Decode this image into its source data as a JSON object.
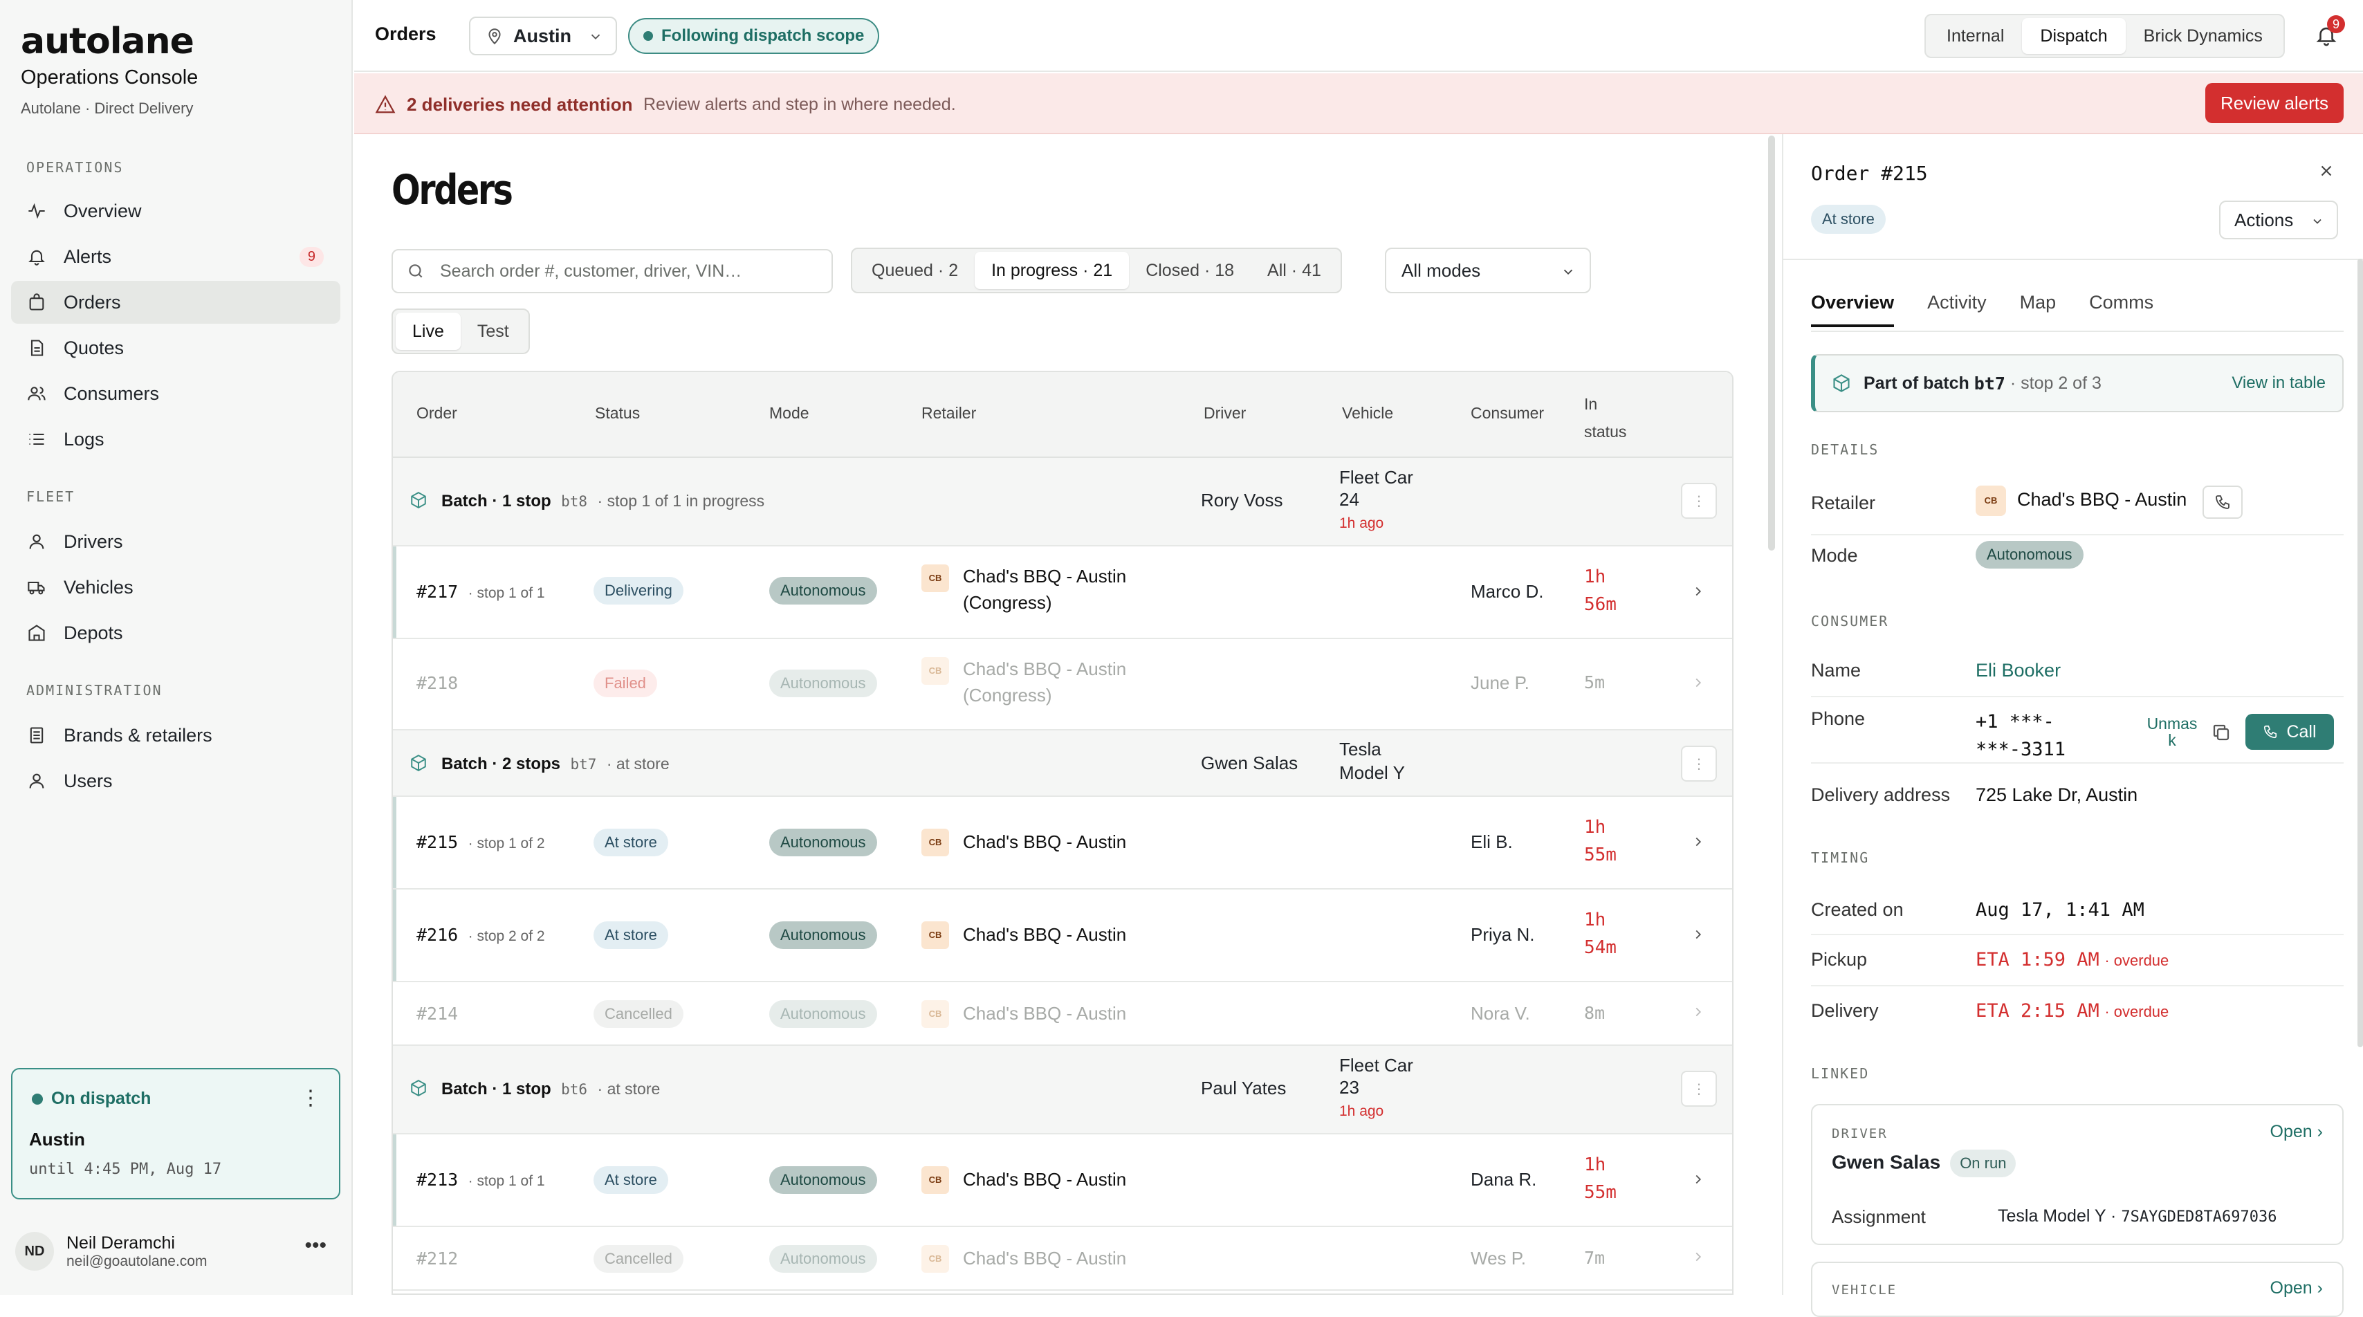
{
  "brand": {
    "logo": "autolane",
    "title": "Operations Console",
    "subtitle": "Autolane · Direct Delivery"
  },
  "sidebar": {
    "sections": {
      "operations": "OPERATIONS",
      "fleet": "FLEET",
      "administration": "ADMINISTRATION"
    },
    "items": [
      {
        "label": "Overview",
        "icon": "pulse-icon"
      },
      {
        "label": "Alerts",
        "icon": "bell-icon",
        "badge": "9"
      },
      {
        "label": "Orders",
        "icon": "bag-icon",
        "active": true
      },
      {
        "label": "Quotes",
        "icon": "document-icon"
      },
      {
        "label": "Consumers",
        "icon": "users-icon"
      },
      {
        "label": "Logs",
        "icon": "list-icon"
      },
      {
        "label": "Drivers",
        "icon": "person-icon"
      },
      {
        "label": "Vehicles",
        "icon": "truck-icon"
      },
      {
        "label": "Depots",
        "icon": "building-icon"
      },
      {
        "label": "Brands & retailers",
        "icon": "ledger-icon"
      },
      {
        "label": "Users",
        "icon": "person-icon"
      }
    ],
    "dispatch": {
      "title": "On dispatch",
      "city": "Austin",
      "until": "until 4:45 PM, Aug 17"
    },
    "user": {
      "initials": "ND",
      "name": "Neil Deramchi",
      "email": "neil@goautolane.com"
    }
  },
  "topbar": {
    "section": "Orders",
    "city": "Austin",
    "scope": "Following dispatch scope",
    "views": [
      "Internal",
      "Dispatch",
      "Brick Dynamics"
    ],
    "active_view": "Dispatch",
    "notifications": "9"
  },
  "alert": {
    "title": "2 deliveries need attention",
    "text": "Review alerts and step in where needed.",
    "button": "Review alerts"
  },
  "main": {
    "title": "Orders",
    "search_placeholder": "Search order #, customer, driver, VIN…",
    "filters": [
      {
        "label": "Queued",
        "count": "2"
      },
      {
        "label": "In progress",
        "count": "21",
        "active": true
      },
      {
        "label": "Closed",
        "count": "18"
      },
      {
        "label": "All",
        "count": "41"
      }
    ],
    "modes": "All modes",
    "env": [
      "Live",
      "Test"
    ],
    "env_active": "Live"
  },
  "table": {
    "headers": {
      "order": "Order",
      "status": "Status",
      "mode": "Mode",
      "retailer": "Retailer",
      "driver": "Driver",
      "vehicle": "Vehicle",
      "consumer": "Consumer",
      "in_status_1": "In",
      "in_status_2": "status"
    },
    "rows": [
      {
        "kind": "batch",
        "title": "Batch · 1 stop",
        "code": "bt8",
        "note": "· stop 1 of 1 in progress",
        "driver": "Rory Voss",
        "vehicle": "Fleet Car 24",
        "vehicle_1": "Fleet Car",
        "vehicle_2": "24",
        "ago": "1h ago"
      },
      {
        "kind": "order",
        "no": "#217",
        "stop": "· stop 1 of 1",
        "status": "Delivering",
        "mode": "Autonomous",
        "retailer_1": "Chad's BBQ - Austin",
        "retailer_2": "(Congress)",
        "consumer": "Marco D.",
        "time_1": "1h",
        "time_2": "56m"
      },
      {
        "kind": "order-dim",
        "no": "#218",
        "status": "Failed",
        "mode": "Autonomous",
        "retailer_1": "Chad's BBQ - Austin",
        "retailer_2": "(Congress)",
        "consumer": "June P.",
        "time": "5m"
      },
      {
        "kind": "batch",
        "title": "Batch · 2 stops",
        "code": "bt7",
        "note": "· at store",
        "driver": "Gwen Salas",
        "vehicle_1": "Tesla",
        "vehicle_2": "Model Y"
      },
      {
        "kind": "order",
        "no": "#215",
        "stop": "· stop 1 of 2",
        "status": "At store",
        "mode": "Autonomous",
        "retailer_1": "Chad's BBQ - Austin",
        "consumer": "Eli B.",
        "time_1": "1h",
        "time_2": "55m"
      },
      {
        "kind": "order",
        "no": "#216",
        "stop": "· stop 2 of 2",
        "status": "At store",
        "mode": "Autonomous",
        "retailer_1": "Chad's BBQ - Austin",
        "consumer": "Priya N.",
        "time_1": "1h",
        "time_2": "54m"
      },
      {
        "kind": "order-dim",
        "no": "#214",
        "status": "Cancelled",
        "mode": "Autonomous",
        "retailer_1": "Chad's BBQ - Austin",
        "consumer": "Nora V.",
        "time": "8m"
      },
      {
        "kind": "batch",
        "title": "Batch · 1 stop",
        "code": "bt6",
        "note": "· at store",
        "driver": "Paul Yates",
        "vehicle_1": "Fleet Car",
        "vehicle_2": "23",
        "ago": "1h ago"
      },
      {
        "kind": "order",
        "no": "#213",
        "stop": "· stop 1 of 1",
        "status": "At store",
        "mode": "Autonomous",
        "retailer_1": "Chad's BBQ - Austin",
        "consumer": "Dana R.",
        "time_1": "1h",
        "time_2": "55m"
      },
      {
        "kind": "order-dim",
        "no": "#212",
        "status": "Cancelled",
        "mode": "Autonomous",
        "retailer_1": "Chad's BBQ - Austin",
        "consumer": "Wes P.",
        "time": "7m"
      }
    ],
    "logo_text": "CB"
  },
  "panel": {
    "title": "Order #215",
    "status": "At store",
    "actions": "Actions",
    "tabs": [
      "Overview",
      "Activity",
      "Map",
      "Comms"
    ],
    "batch": {
      "prefix": "Part of batch",
      "code": "bt7",
      "stop": "· stop 2 of 3",
      "link": "View in table"
    },
    "details_label": "DETAILS",
    "retailer_key": "Retailer",
    "retailer": "Chad's BBQ - Austin",
    "mode_key": "Mode",
    "mode": "Autonomous",
    "consumer_label": "CONSUMER",
    "name_key": "Name",
    "name": "Eli Booker",
    "phone_key": "Phone",
    "phone_1": "+1 ***-",
    "phone_2": "***-3311",
    "unmask": "Unmask",
    "unmask_1": "Unmas",
    "unmask_2": "k",
    "call": "Call",
    "address_key": "Delivery address",
    "address": "725 Lake Dr, Austin",
    "timing_label": "TIMING",
    "created_key": "Created on",
    "created": "Aug 17, 1:41 AM",
    "pickup_key": "Pickup",
    "pickup": "ETA 1:59 AM",
    "pickup_note": "· overdue",
    "delivery_key": "Delivery",
    "delivery": "ETA 2:15 AM",
    "delivery_note": "· overdue",
    "linked_label": "LINKED",
    "driver_label": "DRIVER",
    "driver_name": "Gwen Salas",
    "driver_badge": "On run",
    "open": "Open",
    "assignment_key": "Assignment",
    "assignment_vehicle": "Tesla Model Y ·",
    "assignment_vin": "7SAYGDED8TA697036",
    "vehicle_label": "VEHICLE"
  },
  "colors": {
    "accent": "#2f7d74",
    "danger": "#d32f2f",
    "sidebar_bg": "#f6f7f6",
    "alert_bg": "#fbe9e8"
  }
}
